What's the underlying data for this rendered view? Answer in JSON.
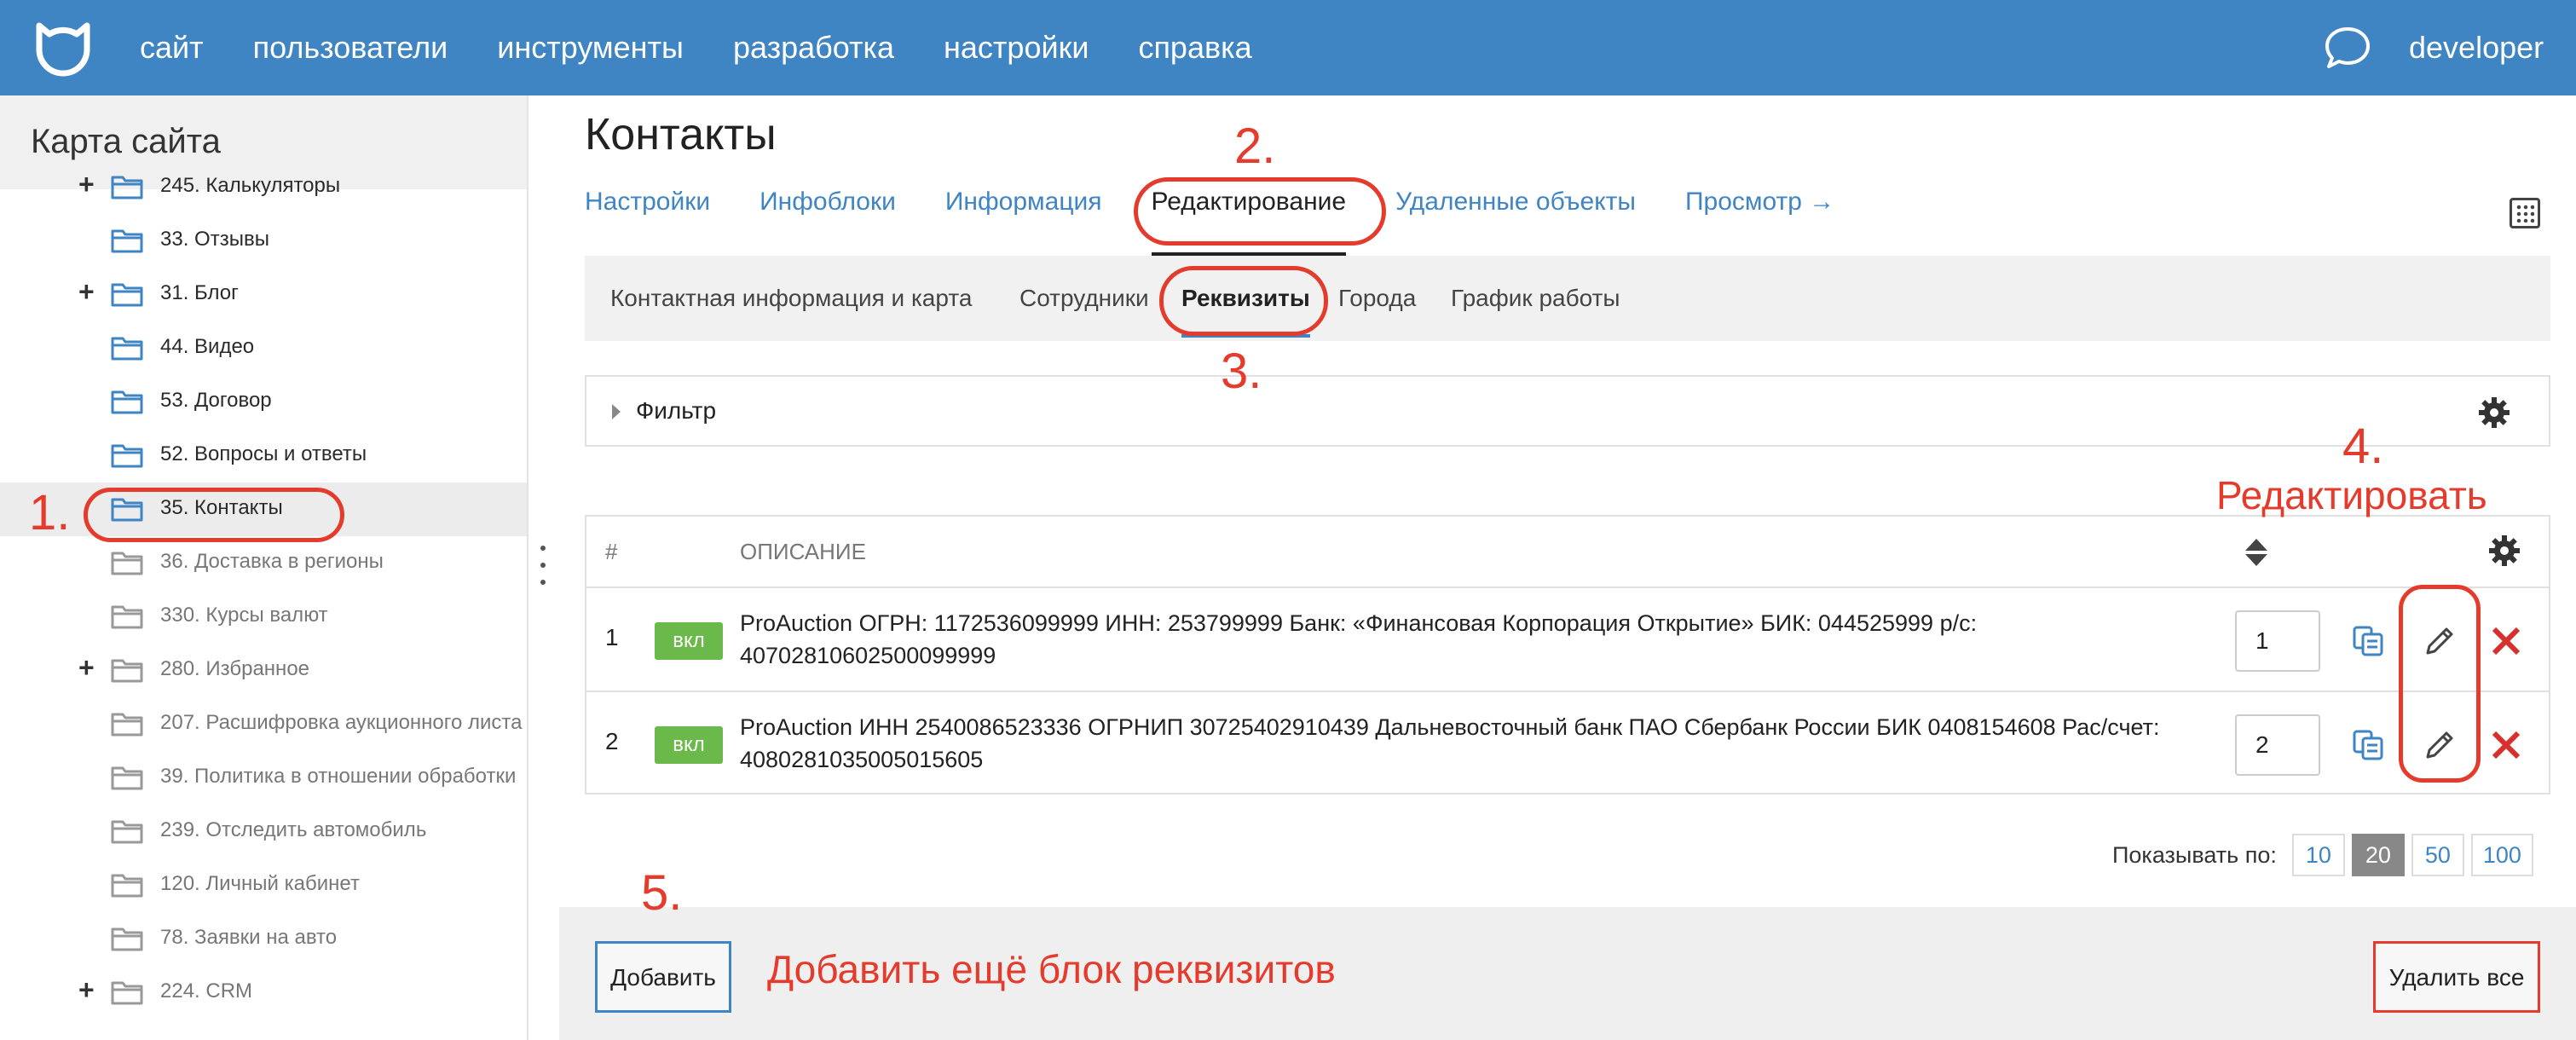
{
  "topbar": {
    "nav": [
      "сайт",
      "пользователи",
      "инструменты",
      "разработка",
      "настройки",
      "справка"
    ],
    "user": "developer",
    "accent": "#3f84c3"
  },
  "sidebar": {
    "title": "Карта сайта",
    "items": [
      {
        "label": "245. Калькуляторы",
        "expandable": true,
        "style": "dark"
      },
      {
        "label": "33. Отзывы",
        "expandable": false,
        "style": "dark"
      },
      {
        "label": "31. Блог",
        "expandable": true,
        "style": "dark"
      },
      {
        "label": "44. Видео",
        "expandable": false,
        "style": "dark"
      },
      {
        "label": "53. Договор",
        "expandable": false,
        "style": "dark"
      },
      {
        "label": "52. Вопросы и ответы",
        "expandable": false,
        "style": "dark"
      },
      {
        "label": "35. Контакты",
        "expandable": false,
        "style": "dark",
        "active": true
      },
      {
        "label": "36. Доставка в регионы",
        "expandable": false,
        "style": "muted"
      },
      {
        "label": "330. Курсы валют",
        "expandable": false,
        "style": "muted"
      },
      {
        "label": "280. Избранное",
        "expandable": true,
        "style": "muted"
      },
      {
        "label": "207. Расшифровка аукционного листа",
        "expandable": false,
        "style": "muted"
      },
      {
        "label": "39. Политика в отношении обработки",
        "expandable": false,
        "style": "muted"
      },
      {
        "label": "239. Отследить автомобиль",
        "expandable": false,
        "style": "muted"
      },
      {
        "label": "120. Личный кабинет",
        "expandable": false,
        "style": "muted"
      },
      {
        "label": "78. Заявки на авто",
        "expandable": false,
        "style": "muted"
      },
      {
        "label": "224. CRM",
        "expandable": true,
        "style": "muted"
      }
    ]
  },
  "main": {
    "title": "Контакты",
    "tabs": [
      {
        "label": "Настройки",
        "active": false
      },
      {
        "label": "Инфоблоки",
        "active": false
      },
      {
        "label": "Информация",
        "active": false
      },
      {
        "label": "Редактирование",
        "active": true
      },
      {
        "label": "Удаленные объекты",
        "active": false
      },
      {
        "label": "Просмотр →",
        "active": false
      }
    ],
    "subtabs": [
      {
        "label": "Контактная информация и карта",
        "active": false
      },
      {
        "label": "Сотрудники",
        "active": false
      },
      {
        "label": "Реквизиты",
        "active": true
      },
      {
        "label": "Города",
        "active": false
      },
      {
        "label": "График работы",
        "active": false
      }
    ],
    "filter_label": "Фильтр",
    "table": {
      "headers": {
        "num": "#",
        "description": "ОПИСАНИЕ"
      },
      "rows": [
        {
          "num": "1",
          "badge": "вкл",
          "description": "ProAuction ОГРН: 1172536099999 ИНН: 253799999 Банк: «Финансовая Корпорация Открытие» БИК: 044525999 р/с: 40702810602500099999",
          "order": "1"
        },
        {
          "num": "2",
          "badge": "вкл",
          "description": "ProAuction ИНН 2540086523336 ОГРНИП 30725402910439 Дальневосточный банк ПАО Сбербанк России БИК 0408154608 Рас/счет: 4080281035005015605",
          "order": "2"
        }
      ]
    },
    "pager": {
      "label": "Показывать по:",
      "options": [
        "10",
        "20",
        "50",
        "100"
      ],
      "selected": "20"
    },
    "footer": {
      "add_label": "Добавить",
      "delete_all_label": "Удалить все"
    }
  },
  "annotations": {
    "step1": "1.",
    "step2": "2.",
    "step3": "3.",
    "step4": "4.",
    "step4_text": "Редактировать",
    "step5": "5.",
    "step5_text": "Добавить ещё блок реквизитов",
    "color": "#e53b2d"
  }
}
